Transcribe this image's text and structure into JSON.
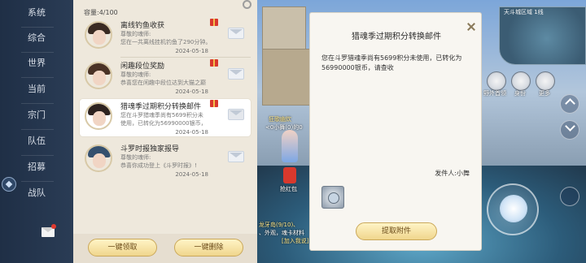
{
  "nav": {
    "items": [
      "系统",
      "综合",
      "世界",
      "当前",
      "宗门",
      "队伍",
      "招募",
      "战队"
    ]
  },
  "mail_panel": {
    "capacity": "容量:4/100",
    "mails": [
      {
        "title": "离线钓鱼收获",
        "line1": "尊敬的魂师:",
        "line2": "您在一共离线挂机钓鱼了290分钟。",
        "date": "2024-05-18",
        "has_gift": true,
        "avatar_hair": "#3a2a22"
      },
      {
        "title": "闲趣段位奖励",
        "line1": "尊敬的魂师:",
        "line2": "恭喜您在闲趣中段位达到大猫之巅",
        "date": "2024-05-18",
        "has_gift": true,
        "avatar_hair": "#4a3226"
      },
      {
        "title": "猎魂季过期积分转换邮件",
        "line1": "您在斗罗猎魂季尚有5699积分未",
        "line2": "使用，已转化为56990000银币，",
        "date": "2024-05-18",
        "has_gift": true,
        "avatar_hair": "#2e2320"
      },
      {
        "title": "斗罗时报独家报导",
        "line1": "尊敬的魂师:",
        "line2": "恭喜你成功登上《斗罗时报》!",
        "date": "2024-05-18",
        "has_gift": false,
        "avatar_hair": "#35506e"
      }
    ],
    "claim_all_label": "一键领取",
    "delete_all_label": "一键删除"
  },
  "detail": {
    "title": "猎魂季过期积分转换邮件",
    "body": "您在斗罗猎魂季尚有5699积分未使用，已转化为56990000银币，请查收",
    "sender": "发件人:小舞",
    "claim_label": "提取附件"
  },
  "scene": {
    "minimap_label": "天斗城区域 1线",
    "hud": [
      "野外首领",
      "身份",
      "更多"
    ],
    "floating_texts": [
      "狂歌幽炊",
      "<0小舞(0)的0",
      "抢红包"
    ],
    "chat_lines": [
      "龙牙岛(9/10)、",
      "、外观，魂卡材料",
      "[加入我说]"
    ]
  },
  "colors": {
    "nav_bg": "#1f2f46",
    "panel_bg": "#eee8dc",
    "button_gold": "#f0d68d",
    "gift_red": "#d9382e"
  }
}
